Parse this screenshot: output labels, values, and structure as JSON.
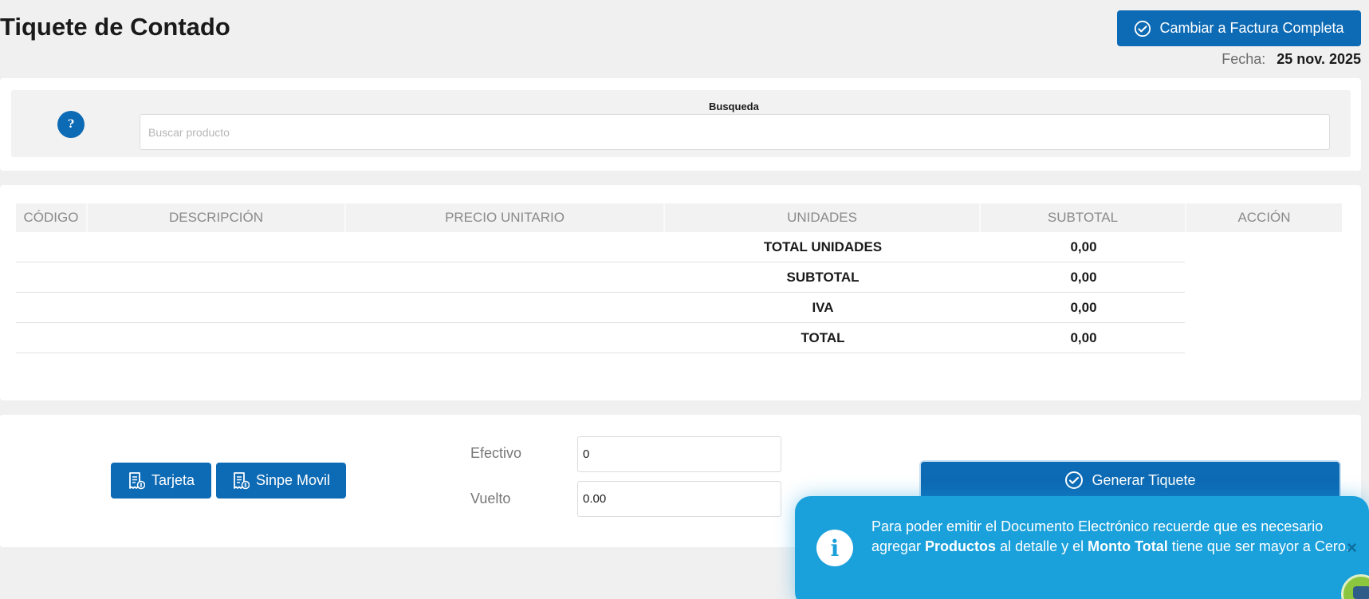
{
  "page": {
    "title": "Tiquete de Contado"
  },
  "header": {
    "switch_button": "Cambiar a Factura Completa",
    "date_label": "Fecha:",
    "date_value": "25 nov. 2025"
  },
  "search": {
    "help_symbol": "?",
    "label": "Busqueda",
    "placeholder": "Buscar producto",
    "value": ""
  },
  "table": {
    "columns": [
      "CÓDIGO",
      "DESCRIPCIÓN",
      "PRECIO UNITARIO",
      "UNIDADES",
      "SUBTOTAL",
      "ACCIÓN"
    ],
    "summary": [
      {
        "label": "TOTAL UNIDADES",
        "value": "0,00"
      },
      {
        "label": "SUBTOTAL",
        "value": "0,00"
      },
      {
        "label": "IVA",
        "value": "0,00"
      },
      {
        "label": "TOTAL",
        "value": "0,00"
      }
    ]
  },
  "payment": {
    "card_button": "Tarjeta",
    "sinpe_button": "Sinpe Movil",
    "cash_label": "Efectivo",
    "cash_value": "0",
    "change_label": "Vuelto",
    "change_value": "0.00",
    "generate_button": "Generar Tiquete"
  },
  "toast": {
    "icon_symbol": "i",
    "text_1": "Para poder emitir el Documento Electrónico recuerde que es necesario agregar ",
    "bold_1": "Productos",
    "text_2": " al detalle y el ",
    "bold_2": "Monto Total",
    "text_3": " tiene que ser mayor a Cero.",
    "close_symbol": "×"
  },
  "icons": {
    "switch_button": "check-circle-icon",
    "help": "question-icon",
    "card_button": "receipt-dollar-icon",
    "sinpe_button": "receipt-dollar-icon",
    "generate_button": "check-circle-icon",
    "toast": "info-icon",
    "chat": "robot-icon"
  },
  "colors": {
    "primary": "#0d6ab4",
    "toast": "#1aa0db",
    "background": "#f0f0f0"
  }
}
